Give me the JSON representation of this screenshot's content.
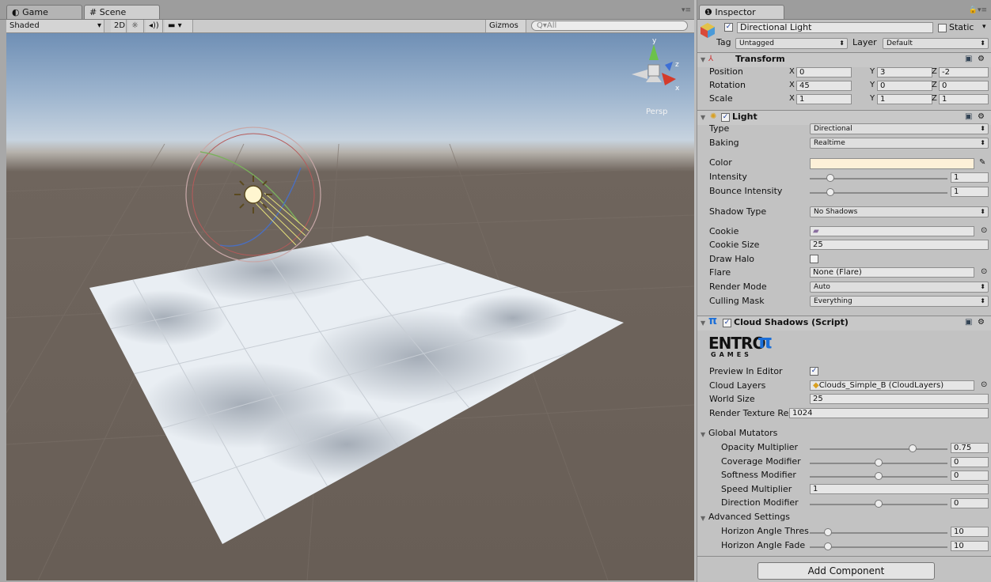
{
  "scene": {
    "tabs": [
      {
        "label": "Game",
        "icon": "pacman-icon"
      },
      {
        "label": "Scene",
        "icon": "grid-icon"
      }
    ],
    "toolbar": {
      "shading_mode": "Shaded",
      "mode_2d": "2D",
      "gizmos_label": "Gizmos",
      "search_placeholder": "Q▾All"
    },
    "gizmo": {
      "y_label": "y",
      "z_label": "z",
      "x_label": "x",
      "projection": "Persp"
    },
    "colors": {
      "sky": "#9fb6cf",
      "ground": "#685e56",
      "plane": "#e9eef3"
    }
  },
  "inspector": {
    "tab_label": "Inspector",
    "object": {
      "name": "Directional Light",
      "active": true,
      "static_label": "Static",
      "tag_label": "Tag",
      "tag_value": "Untagged",
      "layer_label": "Layer",
      "layer_value": "Default"
    },
    "transform": {
      "title": "Transform",
      "rows": [
        {
          "label": "Position",
          "x": "0",
          "y": "3",
          "z": "-2"
        },
        {
          "label": "Rotation",
          "x": "45",
          "y": "0",
          "z": "0"
        },
        {
          "label": "Scale",
          "x": "1",
          "y": "1",
          "z": "1"
        }
      ],
      "axis": {
        "x": "X",
        "y": "Y",
        "z": "Z"
      }
    },
    "light": {
      "title": "Light",
      "type_label": "Type",
      "type_value": "Directional",
      "baking_label": "Baking",
      "baking_value": "Realtime",
      "color_label": "Color",
      "color_value": "#fdf0d8",
      "intensity_label": "Intensity",
      "intensity_value": "1",
      "bounce_label": "Bounce Intensity",
      "bounce_value": "1",
      "shadow_label": "Shadow Type",
      "shadow_value": "No Shadows",
      "cookie_label": "Cookie",
      "cookie_size_label": "Cookie Size",
      "cookie_size_value": "25",
      "halo_label": "Draw Halo",
      "flare_label": "Flare",
      "flare_value": "None (Flare)",
      "render_mode_label": "Render Mode",
      "render_mode_value": "Auto",
      "culling_label": "Culling Mask",
      "culling_value": "Everything"
    },
    "cloud": {
      "title": "Cloud Shadows (Script)",
      "logo_top": "ENTRO",
      "logo_pi": "π",
      "logo_bottom": "GAMES",
      "preview_label": "Preview In Editor",
      "layers_label": "Cloud Layers",
      "layers_value": "Clouds_Simple_B (CloudLayers)",
      "world_label": "World Size",
      "world_value": "25",
      "rtex_label": "Render Texture Resolu",
      "rtex_value": "1024",
      "global_label": "Global Mutators",
      "opacity_label": "Opacity Multiplier",
      "opacity_value": "0.75",
      "coverage_label": "Coverage Modifier",
      "coverage_value": "0",
      "softness_label": "Softness Modifier",
      "softness_value": "0",
      "speed_label": "Speed Multiplier",
      "speed_value": "1",
      "direction_label": "Direction Modifier",
      "direction_value": "0",
      "advanced_label": "Advanced Settings",
      "hthres_label": "Horizon Angle Thres",
      "hthres_value": "10",
      "hfade_label": "Horizon Angle Fade",
      "hfade_value": "10"
    },
    "add_component": "Add Component"
  }
}
